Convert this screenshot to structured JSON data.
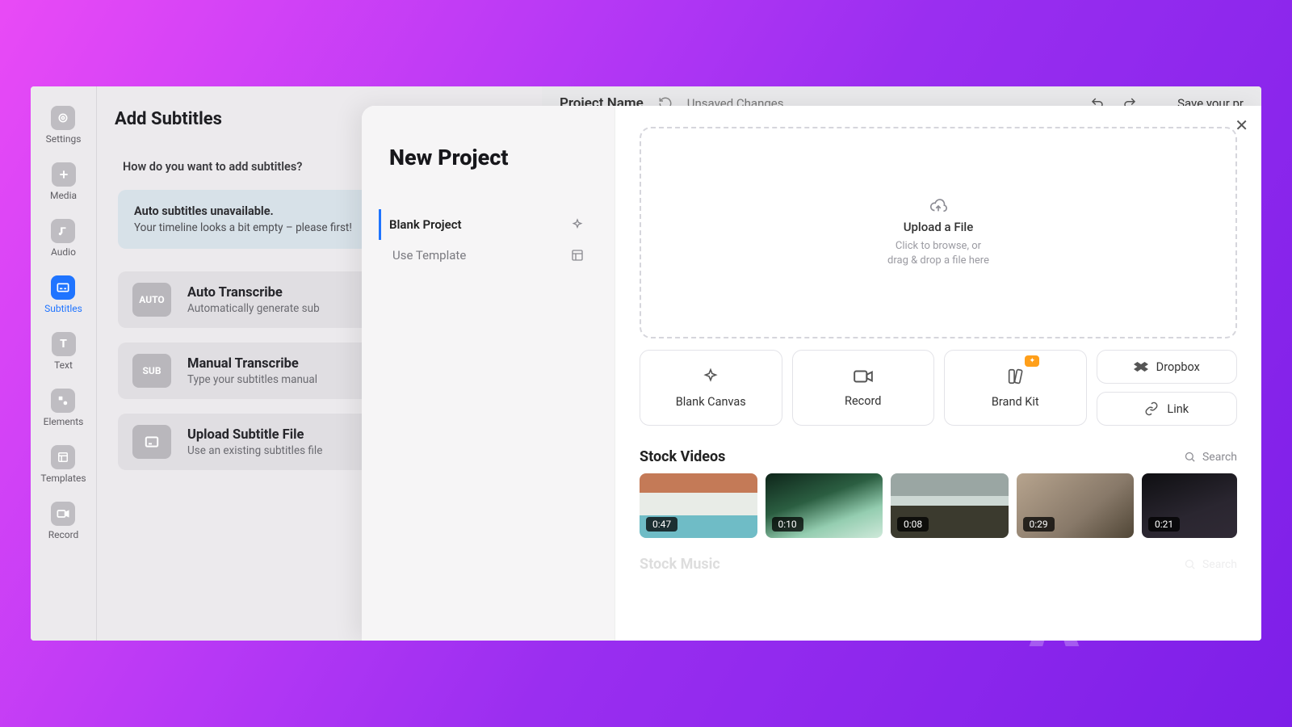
{
  "rail": {
    "items": [
      {
        "label": "Settings",
        "icon": "settings"
      },
      {
        "label": "Media",
        "icon": "plus"
      },
      {
        "label": "Audio",
        "icon": "music"
      },
      {
        "label": "Subtitles",
        "icon": "subtitles",
        "active": true
      },
      {
        "label": "Text",
        "icon": "text"
      },
      {
        "label": "Elements",
        "icon": "shapes"
      },
      {
        "label": "Templates",
        "icon": "template"
      },
      {
        "label": "Record",
        "icon": "record"
      }
    ]
  },
  "panel": {
    "title": "Add Subtitles",
    "question": "How do you want to add subtitles?",
    "notice": {
      "title": "Auto subtitles unavailable.",
      "body": "Your timeline looks a bit empty – please first!"
    },
    "options": [
      {
        "badge": "AUTO",
        "title": "Auto Transcribe",
        "sub": "Automatically generate sub"
      },
      {
        "badge": "SUB",
        "title": "Manual Transcribe",
        "sub": "Type your subtitles manual"
      },
      {
        "badge": "",
        "title": "Upload Subtitle File",
        "sub": "Use an existing subtitles file"
      }
    ]
  },
  "topbar": {
    "project": "Project Name",
    "status": "Unsaved Changes",
    "save": "Save your pr"
  },
  "modal": {
    "title": "New Project",
    "left": [
      {
        "label": "Blank Project",
        "active": true,
        "icon": "sparkle"
      },
      {
        "label": "Use Template",
        "active": false,
        "icon": "template"
      }
    ],
    "dropzone": {
      "title": "Upload a File",
      "line1": "Click to browse, or",
      "line2": "drag & drop a file here"
    },
    "cards": {
      "blank": "Blank Canvas",
      "record": "Record",
      "brandkit": "Brand Kit",
      "dropbox": "Dropbox",
      "link": "Link"
    },
    "stock_videos": {
      "title": "Stock Videos",
      "search": "Search",
      "items": [
        {
          "duration": "0:47"
        },
        {
          "duration": "0:10"
        },
        {
          "duration": "0:08"
        },
        {
          "duration": "0:29"
        },
        {
          "duration": "0:21"
        }
      ]
    },
    "stock_music": {
      "title": "Stock Music",
      "search": "Search"
    }
  }
}
